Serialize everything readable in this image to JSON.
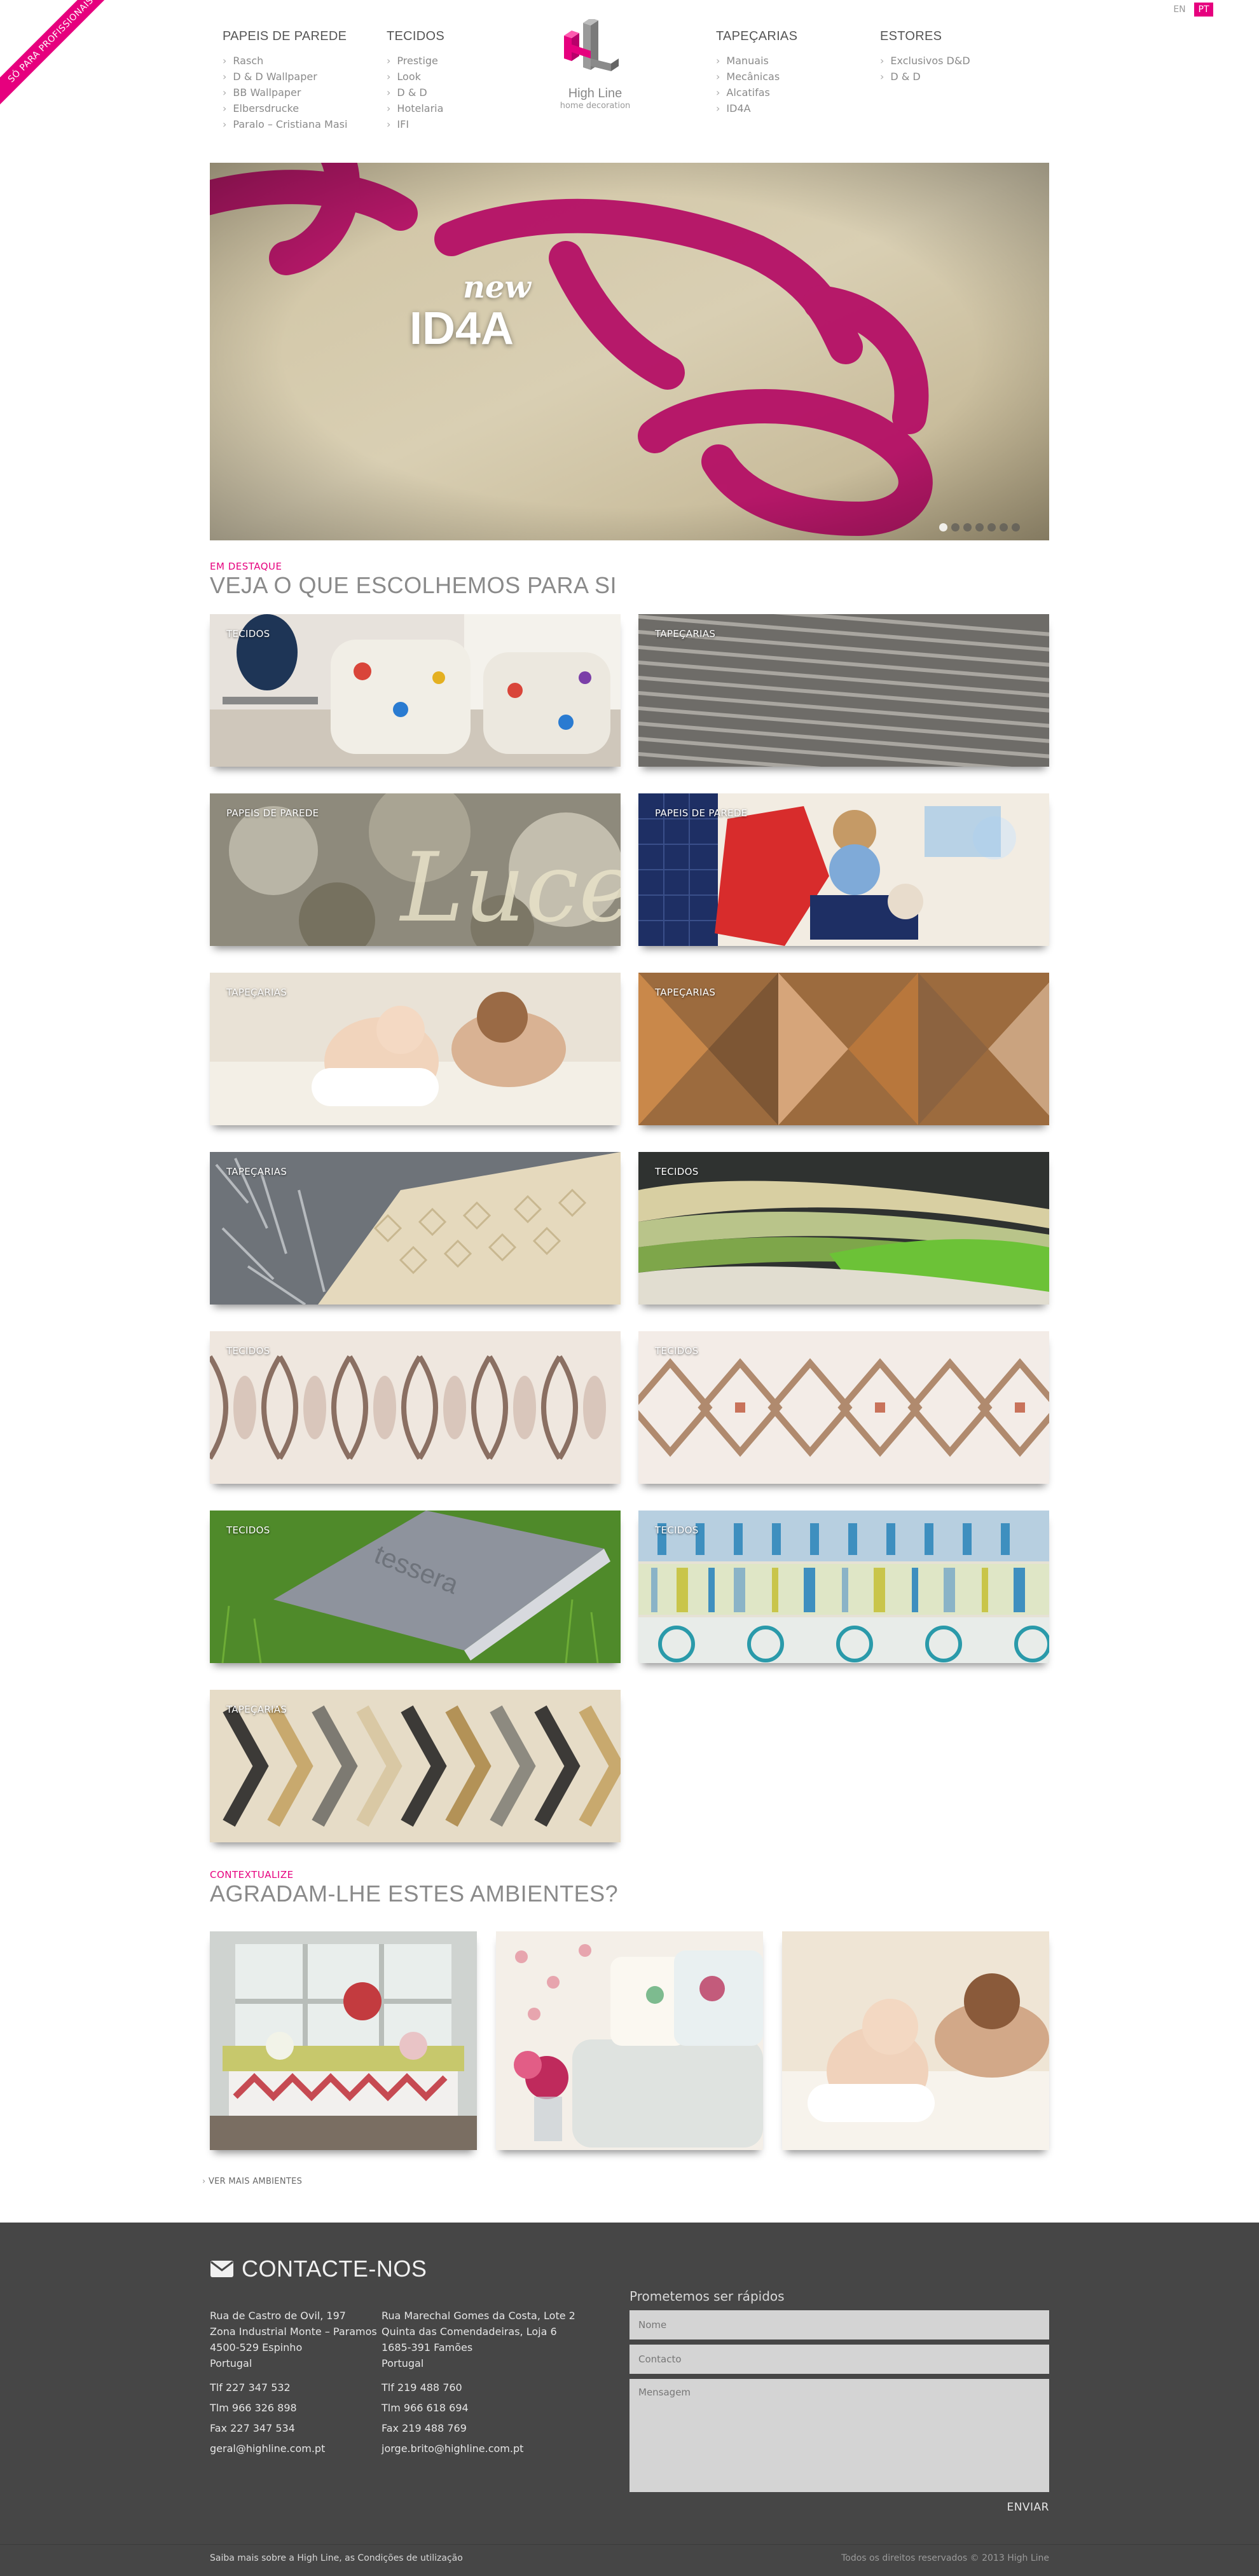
{
  "ribbon": "SÓ PARA PROFISSIONAIS",
  "languages": [
    {
      "label": "EN",
      "active": false
    },
    {
      "label": "PT",
      "active": true
    }
  ],
  "nav": [
    {
      "title": "PAPEIS DE PAREDE",
      "items": [
        "Rasch",
        "D & D Wallpaper",
        "BB Wallpaper",
        "Elbersdrucke",
        "Paralo – Cristiana Masi"
      ]
    },
    {
      "title": "TECIDOS",
      "items": [
        "Prestige",
        "Look",
        "D & D",
        "Hotelaria",
        "IFI"
      ]
    },
    {
      "title": "TAPEÇARIAS",
      "items": [
        "Manuais",
        "Mecânicas",
        "Alcatifas",
        "ID4A"
      ]
    },
    {
      "title": "ESTORES",
      "items": [
        "Exclusivos D&D",
        "D & D"
      ]
    }
  ],
  "logo": {
    "name": "High Line",
    "tagline": "home decoration",
    "accent": "#e6007e"
  },
  "hero": {
    "kicker": "new",
    "title": "ID4A",
    "slides": 7,
    "active_slide": 0
  },
  "featured": {
    "kicker": "EM DESTAQUE",
    "title": "VEJA O QUE ESCOLHEMOS PARA SI",
    "tiles": [
      "TECIDOS",
      "TAPEÇARIAS",
      "PAPEIS DE PAREDE",
      "PAPEIS DE PAREDE",
      "TAPEÇARIAS",
      "TAPEÇARIAS",
      "TAPEÇARIAS",
      "TECIDOS",
      "TECIDOS",
      "TECIDOS",
      "TECIDOS",
      "TECIDOS",
      "TAPEÇARIAS"
    ]
  },
  "ambients": {
    "kicker": "CONTEXTUALIZE",
    "title": "AGRADAM-LHE ESTES AMBIENTES?",
    "more_link": "VER MAIS AMBIENTES"
  },
  "contact": {
    "title": "CONTACTE-NOS",
    "offices": [
      {
        "lines": [
          "Rua de Castro de Ovil, 197",
          "Zona Industrial Monte – Paramos",
          "4500-529 Espinho",
          "Portugal"
        ],
        "tlf": "Tlf  227 347 532",
        "tlm": "Tlm  966 326 898",
        "fax": "Fax  227 347 534",
        "email": "geral@highline.com.pt"
      },
      {
        "lines": [
          "Rua Marechal Gomes da Costa, Lote 2",
          "Quinta das Comendadeiras, Loja 6",
          "1685-391 Famões",
          "Portugal"
        ],
        "tlf": "Tlf  219 488 760",
        "tlm": "Tlm  966 618 694",
        "fax": "Fax  219 488 769",
        "email": "jorge.brito@highline.com.pt"
      }
    ],
    "form": {
      "title": "Prometemos ser rápidos",
      "name_placeholder": "Nome",
      "contact_placeholder": "Contacto",
      "message_placeholder": "Mensagem",
      "send": "ENVIAR"
    }
  },
  "footer": {
    "left": "Saiba mais sobre a High Line, as Condições de utilização",
    "right": "Todos os direitos reservados © 2013 High Line"
  }
}
